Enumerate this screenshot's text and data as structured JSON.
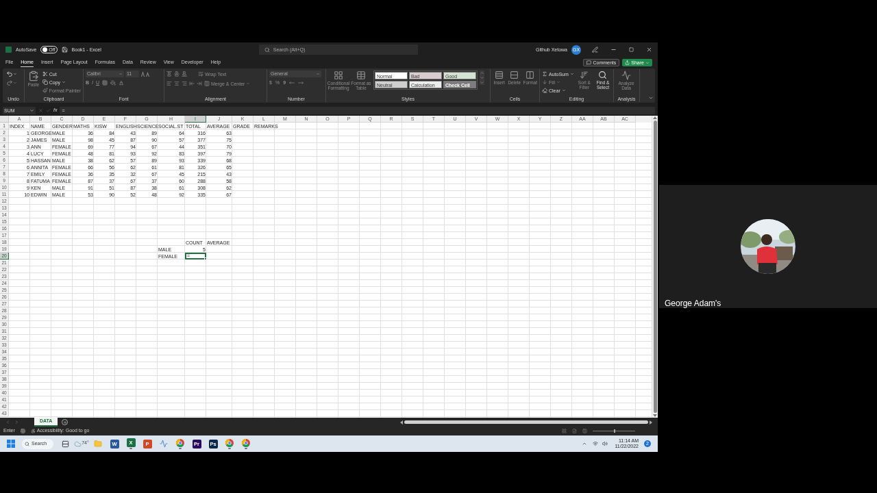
{
  "title_bar": {
    "autosave_label": "AutoSave",
    "autosave": {
      "on": false,
      "label": "Off"
    },
    "title": "Book1 - Excel",
    "search_placeholder": "Search (Alt+Q)",
    "user": "Github Xetowa",
    "user_initials": "GX"
  },
  "menu": {
    "tabs": [
      {
        "label": "File",
        "selected": false
      },
      {
        "label": "Home",
        "selected": true
      },
      {
        "label": "Insert",
        "selected": false
      },
      {
        "label": "Page Layout",
        "selected": false
      },
      {
        "label": "Formulas",
        "selected": false
      },
      {
        "label": "Data",
        "selected": false
      },
      {
        "label": "Review",
        "selected": false
      },
      {
        "label": "View",
        "selected": false
      },
      {
        "label": "Developer",
        "selected": false
      },
      {
        "label": "Help",
        "selected": false
      }
    ],
    "comments": "Comments",
    "share": "Share"
  },
  "ribbon": [
    {
      "kind": "undo",
      "label": "Undo"
    },
    {
      "kind": "clipboard",
      "label": "Clipboard",
      "paste": {
        "label": "Paste",
        "disabled": true
      },
      "cut": {
        "label": "Cut",
        "disabled": false
      },
      "copy": {
        "label": "Copy",
        "disabled": false
      },
      "format_painter": {
        "label": "Format Painter",
        "disabled": true
      }
    },
    {
      "kind": "font",
      "label": "Font",
      "disabled": true,
      "font_name": "Calibri",
      "font_size": "11",
      "bold": "B",
      "italic": "I",
      "underline": "U"
    },
    {
      "kind": "alignment",
      "label": "Alignment",
      "disabled": true,
      "wrap": "Wrap Text",
      "merge": "Merge & Center"
    },
    {
      "kind": "number",
      "label": "Number",
      "disabled": true,
      "format": "General",
      "currency": "$",
      "percent": "%",
      "comma": "9"
    },
    {
      "kind": "styles",
      "label": "Styles",
      "buttons": [
        {
          "label": "Conditional Formatting",
          "disabled": true
        },
        {
          "label": "Format as Table",
          "disabled": true
        }
      ],
      "cell_styles": [
        {
          "label": "Normal",
          "color": "#ffffff"
        },
        {
          "label": "Bad",
          "color": "#d9cdd0"
        },
        {
          "label": "Good",
          "color": "#d3e3d3"
        },
        {
          "label": "Neutral",
          "color": "#cfcfcf"
        },
        {
          "label": "Calculation",
          "color": "#ececec"
        },
        {
          "label": "Check Cell",
          "color": "#7c7c7c"
        }
      ]
    },
    {
      "kind": "cells",
      "label": "Cells",
      "buttons": [
        {
          "label": "Insert",
          "disabled": true
        },
        {
          "label": "Delete",
          "disabled": true
        },
        {
          "label": "Format",
          "disabled": true
        }
      ]
    },
    {
      "kind": "editing",
      "label": "Editing",
      "autosum": {
        "label": "AutoSum",
        "disabled": false
      },
      "fill": {
        "label": "Fill",
        "disabled": true
      },
      "clear": {
        "label": "Clear",
        "disabled": false
      },
      "sort": {
        "label": "Sort & Filter",
        "disabled": true
      },
      "find": {
        "label": "Find & Select",
        "disabled": false
      }
    },
    {
      "kind": "analysis",
      "label": "Analysis",
      "buttons": [
        {
          "label": "Analyze Data",
          "disabled": true
        }
      ]
    }
  ],
  "formula_bar": {
    "name_box": "SUM",
    "function_label": "fx",
    "formula": "="
  },
  "sheet": {
    "columns": [
      {
        "label": "A",
        "selected": false
      },
      {
        "label": "B",
        "selected": false
      },
      {
        "label": "C",
        "selected": false
      },
      {
        "label": "D",
        "selected": false
      },
      {
        "label": "E",
        "selected": false
      },
      {
        "label": "F",
        "selected": false
      },
      {
        "label": "G",
        "selected": false
      },
      {
        "label": "H",
        "selected": false
      },
      {
        "label": "I",
        "selected": true
      },
      {
        "label": "J",
        "selected": false
      },
      {
        "label": "K",
        "selected": false
      },
      {
        "label": "L",
        "selected": false
      },
      {
        "label": "M",
        "selected": false
      },
      {
        "label": "N",
        "selected": false
      },
      {
        "label": "O",
        "selected": false
      },
      {
        "label": "P",
        "selected": false
      },
      {
        "label": "Q",
        "selected": false
      },
      {
        "label": "R",
        "selected": false
      },
      {
        "label": "S",
        "selected": false
      },
      {
        "label": "T",
        "selected": false
      },
      {
        "label": "U",
        "selected": false
      },
      {
        "label": "V",
        "selected": false
      },
      {
        "label": "W",
        "selected": false
      },
      {
        "label": "X",
        "selected": false
      },
      {
        "label": "Y",
        "selected": false
      },
      {
        "label": "Z",
        "selected": false
      },
      {
        "label": "AA",
        "selected": false
      },
      {
        "label": "AB",
        "selected": false
      },
      {
        "label": "AC",
        "selected": false
      }
    ],
    "rows": [
      {
        "number": "1",
        "selected": false,
        "cells": [
          {
            "text": "INDEX",
            "kind": "text"
          },
          {
            "text": "NAME",
            "kind": "text"
          },
          {
            "text": "GENDER",
            "kind": "text"
          },
          {
            "text": "MATHS",
            "kind": "text"
          },
          {
            "text": "KISW",
            "kind": "text"
          },
          {
            "text": "ENGLISH",
            "kind": "text"
          },
          {
            "text": "SCIENCE",
            "kind": "text"
          },
          {
            "text": "SOCIAL.ST",
            "kind": "text"
          },
          {
            "text": "TOTAL",
            "kind": "text"
          },
          {
            "text": "AVERAGE",
            "kind": "text"
          },
          {
            "text": "GRADE",
            "kind": "text"
          },
          {
            "text": "REMARKS",
            "kind": "text"
          }
        ]
      },
      {
        "number": "2",
        "selected": false,
        "cells": [
          {
            "text": "1",
            "kind": "number"
          },
          {
            "text": "GEORGE",
            "kind": "text"
          },
          {
            "text": "MALE",
            "kind": "text"
          },
          {
            "text": "36",
            "kind": "number"
          },
          {
            "text": "84",
            "kind": "number"
          },
          {
            "text": "43",
            "kind": "number"
          },
          {
            "text": "89",
            "kind": "number"
          },
          {
            "text": "64",
            "kind": "number"
          },
          {
            "text": "316",
            "kind": "number"
          },
          {
            "text": "63",
            "kind": "number"
          }
        ]
      },
      {
        "number": "3",
        "selected": false,
        "cells": [
          {
            "text": "2",
            "kind": "number"
          },
          {
            "text": "JAMES",
            "kind": "text"
          },
          {
            "text": "MALE",
            "kind": "text"
          },
          {
            "text": "98",
            "kind": "number"
          },
          {
            "text": "45",
            "kind": "number"
          },
          {
            "text": "87",
            "kind": "number"
          },
          {
            "text": "90",
            "kind": "number"
          },
          {
            "text": "57",
            "kind": "number"
          },
          {
            "text": "377",
            "kind": "number"
          },
          {
            "text": "75",
            "kind": "number"
          }
        ]
      },
      {
        "number": "4",
        "selected": false,
        "cells": [
          {
            "text": "3",
            "kind": "number"
          },
          {
            "text": "ANN",
            "kind": "text"
          },
          {
            "text": "FEMALE",
            "kind": "text"
          },
          {
            "text": "69",
            "kind": "number"
          },
          {
            "text": "77",
            "kind": "number"
          },
          {
            "text": "94",
            "kind": "number"
          },
          {
            "text": "67",
            "kind": "number"
          },
          {
            "text": "44",
            "kind": "number"
          },
          {
            "text": "351",
            "kind": "number"
          },
          {
            "text": "70",
            "kind": "number"
          }
        ]
      },
      {
        "number": "5",
        "selected": false,
        "cells": [
          {
            "text": "4",
            "kind": "number"
          },
          {
            "text": "LUCY",
            "kind": "text"
          },
          {
            "text": "FEMALE",
            "kind": "text"
          },
          {
            "text": "48",
            "kind": "number"
          },
          {
            "text": "81",
            "kind": "number"
          },
          {
            "text": "93",
            "kind": "number"
          },
          {
            "text": "92",
            "kind": "number"
          },
          {
            "text": "83",
            "kind": "number"
          },
          {
            "text": "397",
            "kind": "number"
          },
          {
            "text": "79",
            "kind": "number"
          }
        ]
      },
      {
        "number": "6",
        "selected": false,
        "cells": [
          {
            "text": "5",
            "kind": "number"
          },
          {
            "text": "HASSAN",
            "kind": "text"
          },
          {
            "text": "MALE",
            "kind": "text"
          },
          {
            "text": "38",
            "kind": "number"
          },
          {
            "text": "62",
            "kind": "number"
          },
          {
            "text": "57",
            "kind": "number"
          },
          {
            "text": "89",
            "kind": "number"
          },
          {
            "text": "93",
            "kind": "number"
          },
          {
            "text": "339",
            "kind": "number"
          },
          {
            "text": "68",
            "kind": "number"
          }
        ]
      },
      {
        "number": "7",
        "selected": false,
        "cells": [
          {
            "text": "6",
            "kind": "number"
          },
          {
            "text": "ANNITA",
            "kind": "text"
          },
          {
            "text": "FEMALE",
            "kind": "text"
          },
          {
            "text": "66",
            "kind": "number"
          },
          {
            "text": "56",
            "kind": "number"
          },
          {
            "text": "62",
            "kind": "number"
          },
          {
            "text": "61",
            "kind": "number"
          },
          {
            "text": "81",
            "kind": "number"
          },
          {
            "text": "326",
            "kind": "number"
          },
          {
            "text": "65",
            "kind": "number"
          }
        ]
      },
      {
        "number": "8",
        "selected": false,
        "cells": [
          {
            "text": "7",
            "kind": "number"
          },
          {
            "text": "EMILY",
            "kind": "text"
          },
          {
            "text": "FEMALE",
            "kind": "text"
          },
          {
            "text": "36",
            "kind": "number"
          },
          {
            "text": "35",
            "kind": "number"
          },
          {
            "text": "32",
            "kind": "number"
          },
          {
            "text": "67",
            "kind": "number"
          },
          {
            "text": "45",
            "kind": "number"
          },
          {
            "text": "215",
            "kind": "number"
          },
          {
            "text": "43",
            "kind": "number"
          }
        ]
      },
      {
        "number": "9",
        "selected": false,
        "cells": [
          {
            "text": "8",
            "kind": "number"
          },
          {
            "text": "FATUMA",
            "kind": "text"
          },
          {
            "text": "FEMALE",
            "kind": "text"
          },
          {
            "text": "87",
            "kind": "number"
          },
          {
            "text": "37",
            "kind": "number"
          },
          {
            "text": "67",
            "kind": "number"
          },
          {
            "text": "37",
            "kind": "number"
          },
          {
            "text": "60",
            "kind": "number"
          },
          {
            "text": "288",
            "kind": "number"
          },
          {
            "text": "58",
            "kind": "number"
          }
        ]
      },
      {
        "number": "10",
        "selected": false,
        "cells": [
          {
            "text": "9",
            "kind": "number"
          },
          {
            "text": "KEN",
            "kind": "text"
          },
          {
            "text": "MALE",
            "kind": "text"
          },
          {
            "text": "91",
            "kind": "number"
          },
          {
            "text": "51",
            "kind": "number"
          },
          {
            "text": "87",
            "kind": "number"
          },
          {
            "text": "38",
            "kind": "number"
          },
          {
            "text": "61",
            "kind": "number"
          },
          {
            "text": "308",
            "kind": "number"
          },
          {
            "text": "62",
            "kind": "number"
          }
        ]
      },
      {
        "number": "11",
        "selected": false,
        "cells": [
          {
            "text": "10",
            "kind": "number"
          },
          {
            "text": "EDWIN",
            "kind": "text"
          },
          {
            "text": "MALE",
            "kind": "text"
          },
          {
            "text": "53",
            "kind": "number"
          },
          {
            "text": "90",
            "kind": "number"
          },
          {
            "text": "52",
            "kind": "number"
          },
          {
            "text": "48",
            "kind": "number"
          },
          {
            "text": "92",
            "kind": "number"
          },
          {
            "text": "335",
            "kind": "number"
          },
          {
            "text": "67",
            "kind": "number"
          }
        ]
      },
      {
        "number": "12",
        "selected": false
      },
      {
        "number": "13",
        "selected": false
      },
      {
        "number": "14",
        "selected": false
      },
      {
        "number": "15",
        "selected": false
      },
      {
        "number": "16",
        "selected": false
      },
      {
        "number": "17",
        "selected": false
      },
      {
        "number": "18",
        "selected": false,
        "cells": [
          null,
          null,
          null,
          null,
          null,
          null,
          null,
          null,
          {
            "text": "COUNT",
            "kind": "text"
          },
          {
            "text": "AVERAGE",
            "kind": "text"
          }
        ]
      },
      {
        "number": "19",
        "selected": false,
        "cells": [
          null,
          null,
          null,
          null,
          null,
          null,
          null,
          {
            "text": "MALE",
            "kind": "text"
          },
          {
            "text": "5",
            "kind": "number"
          }
        ]
      },
      {
        "number": "20",
        "selected": true,
        "cells": [
          null,
          null,
          null,
          null,
          null,
          null,
          null,
          {
            "text": "FEMALE",
            "kind": "text"
          },
          {
            "text": "=",
            "kind": "text"
          }
        ]
      },
      {
        "number": "21",
        "selected": false
      },
      {
        "number": "22",
        "selected": false
      },
      {
        "number": "23",
        "selected": false
      },
      {
        "number": "24",
        "selected": false
      },
      {
        "number": "25",
        "selected": false
      },
      {
        "number": "26",
        "selected": false
      },
      {
        "number": "27",
        "selected": false
      },
      {
        "number": "28",
        "selected": false
      },
      {
        "number": "29",
        "selected": false
      },
      {
        "number": "30",
        "selected": false
      },
      {
        "number": "31",
        "selected": false
      },
      {
        "number": "32",
        "selected": false
      },
      {
        "number": "33",
        "selected": false
      },
      {
        "number": "34",
        "selected": false
      },
      {
        "number": "35",
        "selected": false
      },
      {
        "number": "36",
        "selected": false
      },
      {
        "number": "37",
        "selected": false
      },
      {
        "number": "38",
        "selected": false
      },
      {
        "number": "39",
        "selected": false
      },
      {
        "number": "40",
        "selected": false
      },
      {
        "number": "41",
        "selected": false
      },
      {
        "number": "42",
        "selected": false
      },
      {
        "number": "43",
        "selected": false
      }
    ]
  },
  "sheet_tabs": [
    {
      "label": "DATA",
      "selected": true
    }
  ],
  "status_bar": {
    "mode": "Enter",
    "accessibility": "Accessibility: Good to go",
    "zoom_slider": {
      "level": 0.5
    }
  },
  "taskbar": {
    "search": "Search",
    "apps": [
      {
        "kind": "taskview",
        "running": false
      },
      {
        "kind": "weather",
        "glyph": "74°",
        "running": false
      },
      {
        "kind": "folder",
        "running": false
      },
      {
        "kind": "letter",
        "glyph": "W",
        "color": "#2b579a",
        "running": false
      },
      {
        "kind": "letter",
        "glyph": "X",
        "color": "#1d7044",
        "running": true
      },
      {
        "kind": "letter",
        "glyph": "P",
        "color": "#d24726",
        "running": false
      },
      {
        "kind": "chart",
        "running": false
      },
      {
        "kind": "chrome",
        "running": true
      },
      {
        "kind": "letter",
        "glyph": "Pr",
        "color": "#2a0a5e",
        "running": false
      },
      {
        "kind": "letter",
        "glyph": "Ps",
        "color": "#0b2a4a",
        "running": false
      },
      {
        "kind": "chrome",
        "running": true
      },
      {
        "kind": "chrome",
        "running": true
      }
    ],
    "time": "11:14 AM",
    "date": "11/22/2022",
    "notifications": "2"
  },
  "video": {
    "name": "George Adam's"
  }
}
